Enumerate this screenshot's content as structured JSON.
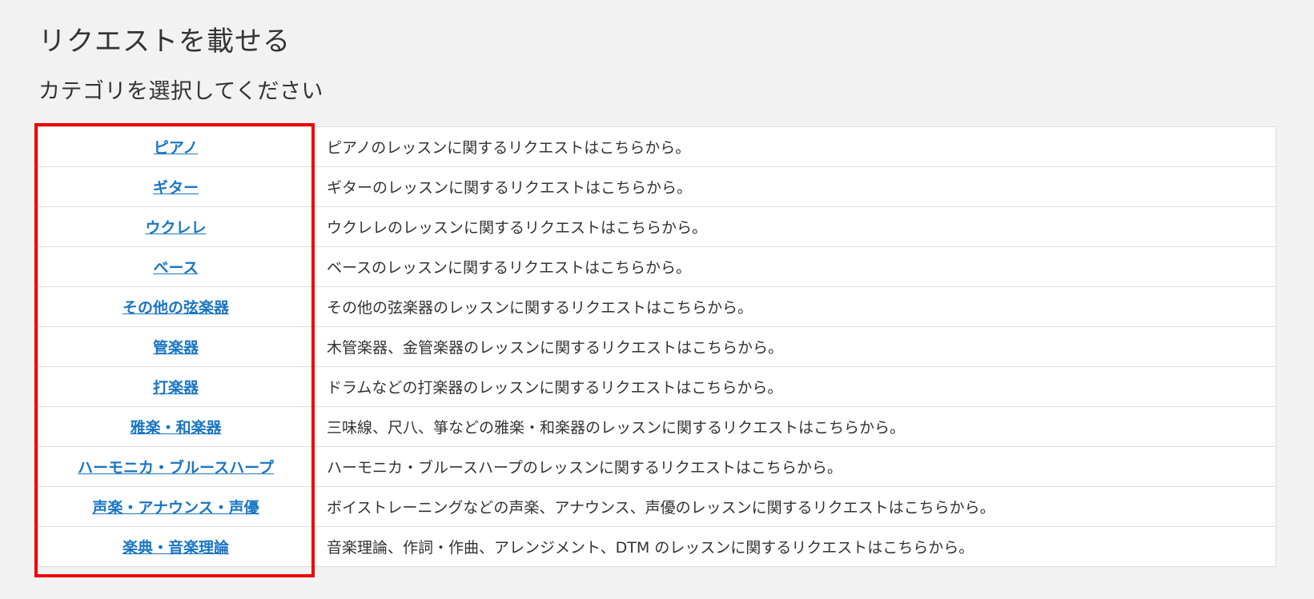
{
  "page": {
    "title": "リクエストを載せる",
    "subtitle": "カテゴリを選択してください"
  },
  "categories": [
    {
      "name": "ピアノ",
      "description": "ピアノのレッスンに関するリクエストはこちらから。"
    },
    {
      "name": "ギター",
      "description": "ギターのレッスンに関するリクエストはこちらから。"
    },
    {
      "name": "ウクレレ",
      "description": "ウクレレのレッスンに関するリクエストはこちらから。"
    },
    {
      "name": "ベース",
      "description": "ベースのレッスンに関するリクエストはこちらから。"
    },
    {
      "name": "その他の弦楽器",
      "description": "その他の弦楽器のレッスンに関するリクエストはこちらから。"
    },
    {
      "name": "管楽器",
      "description": "木管楽器、金管楽器のレッスンに関するリクエストはこちらから。"
    },
    {
      "name": "打楽器",
      "description": "ドラムなどの打楽器のレッスンに関するリクエストはこちらから。"
    },
    {
      "name": "雅楽・和楽器",
      "description": "三味線、尺八、箏などの雅楽・和楽器のレッスンに関するリクエストはこちらから。"
    },
    {
      "name": "ハーモニカ・ブルースハープ",
      "description": "ハーモニカ・ブルースハープのレッスンに関するリクエストはこちらから。"
    },
    {
      "name": "声楽・アナウンス・声優",
      "description": "ボイストレーニングなどの声楽、アナウンス、声優のレッスンに関するリクエストはこちらから。"
    },
    {
      "name": "楽典・音楽理論",
      "description": "音楽理論、作詞・作曲、アレンジメント、DTM のレッスンに関するリクエストはこちらから。"
    }
  ],
  "colors": {
    "background": "#f2f2f2",
    "link": "#1a76c4",
    "highlight_border": "#ee0000",
    "table_border": "#dddddd"
  }
}
